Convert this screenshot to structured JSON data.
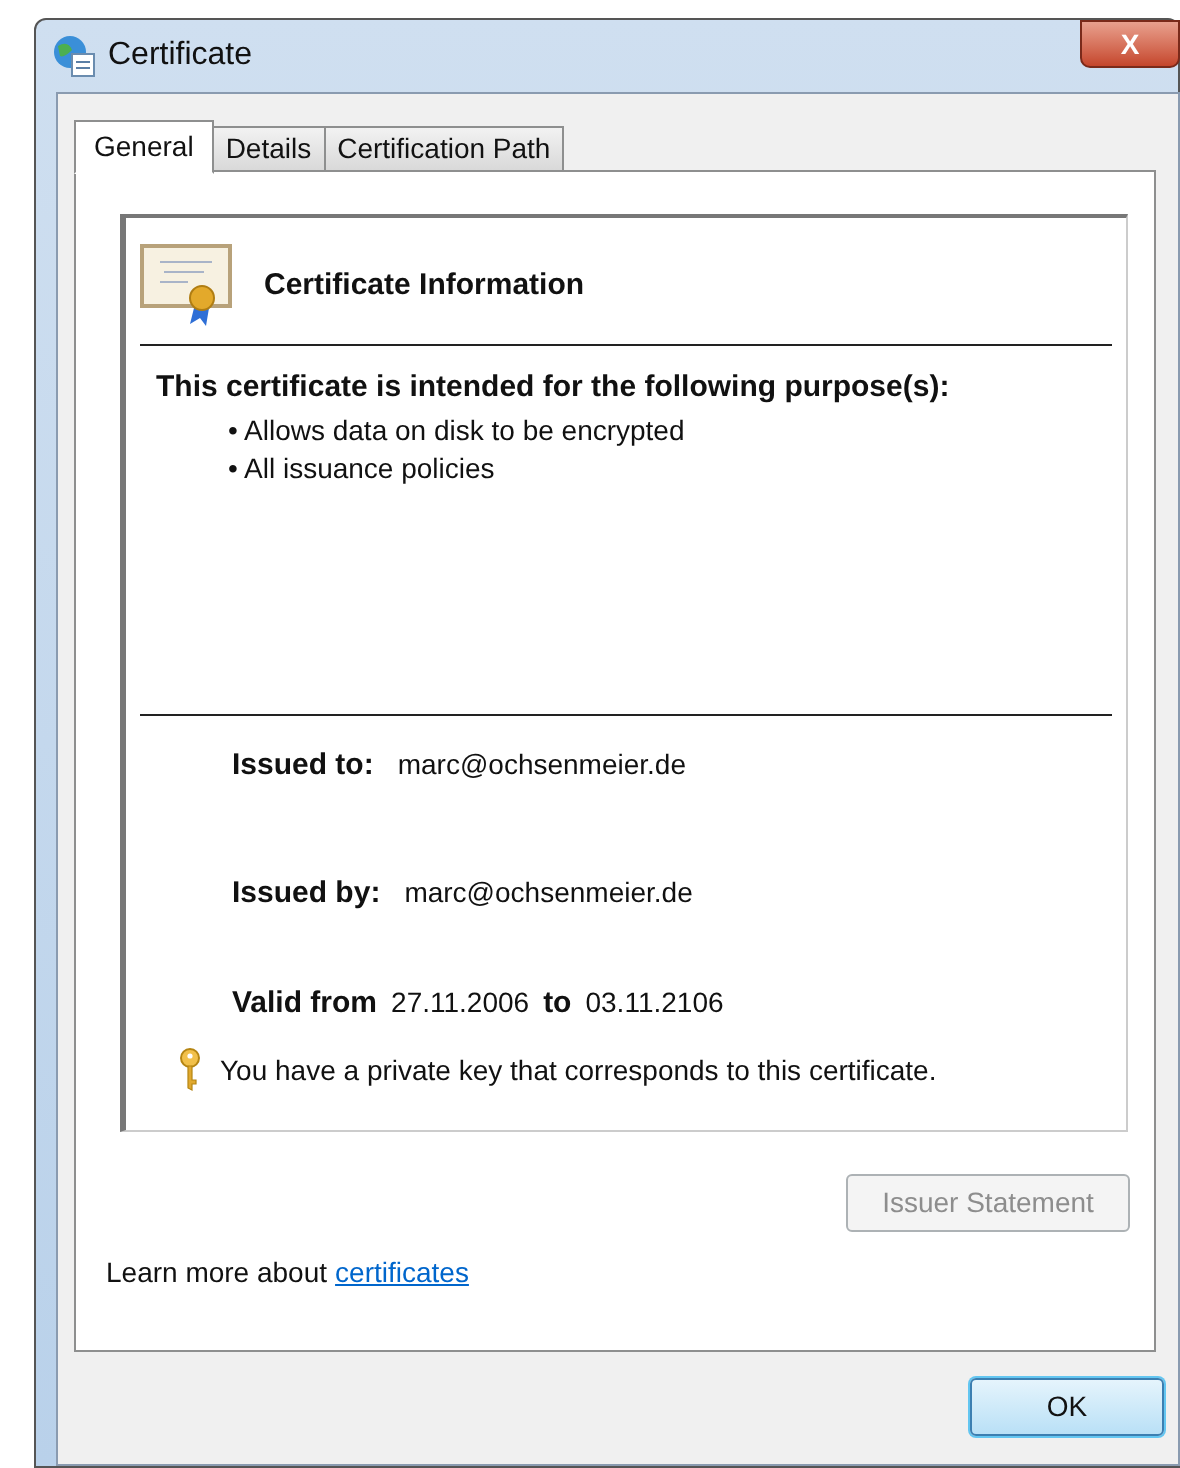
{
  "window": {
    "title": "Certificate",
    "close": "X"
  },
  "tabs": [
    {
      "label": "General",
      "selected": true
    },
    {
      "label": "Details",
      "selected": false
    },
    {
      "label": "Certification Path",
      "selected": false
    }
  ],
  "info": {
    "heading": "Certificate Information",
    "purpose_heading": "This certificate is intended for the following purpose(s):",
    "purposes": [
      "• Allows data on disk to be encrypted",
      "• All issuance policies"
    ],
    "fields": [
      {
        "label": "Issued to:",
        "value": "marc@ochsenmeier.de"
      },
      {
        "label": "Issued by:",
        "value": "marc@ochsenmeier.de"
      }
    ],
    "validity": {
      "from_label": "Valid from",
      "from": "27.11.2006",
      "to_label": "to",
      "to": "03.11.2106"
    },
    "key_note": "You have a private key that corresponds to this certificate."
  },
  "issuer_button": {
    "label": "Issuer Statement",
    "disabled": true
  },
  "learn_more": {
    "text": "Learn more about",
    "link": "certificates"
  },
  "ok_button": {
    "label": "OK",
    "disabled": false
  }
}
